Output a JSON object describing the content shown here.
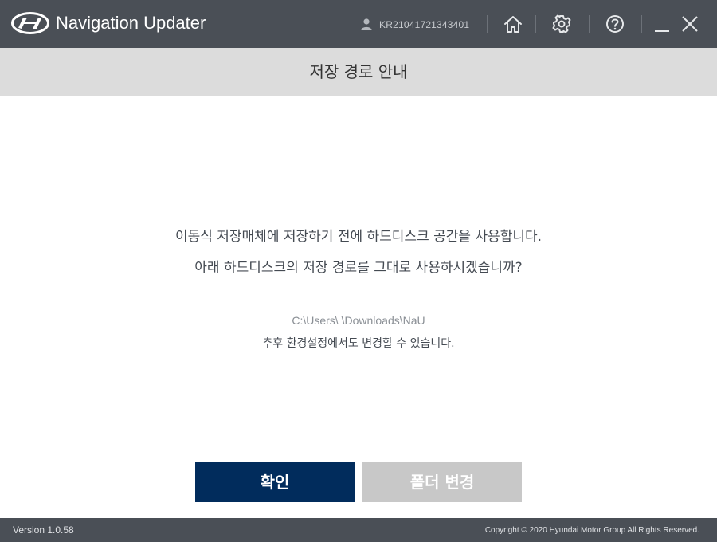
{
  "app": {
    "title": "Navigation Updater",
    "logo_icon": "hyundai-logo-icon",
    "user_id": "KR21041721343401"
  },
  "toolbar": {
    "icons": [
      "user-icon",
      "home-icon",
      "gear-icon",
      "help-icon",
      "minimize-icon",
      "close-icon"
    ]
  },
  "dialog": {
    "title": "저장 경로 안내",
    "message_line1": "이동식 저장매체에 저장하기 전에 하드디스크 공간을 사용합니다.",
    "message_line2": "아래 하드디스크의 저장 경로를 그대로 사용하시겠습니까?",
    "path": "C:\\Users\\     \\Downloads\\NaU",
    "note": "추후 환경설정에서도 변경할 수 있습니다.",
    "confirm_label": "확인",
    "change_folder_label": "폴더 변경"
  },
  "footer": {
    "version": "Version 1.0.58",
    "copyright": "Copyright © 2020 Hyundai Motor Group All Rights Reserved."
  },
  "colors": {
    "titlebar_bg": "#4a4f56",
    "subheader_bg": "#dcdcdc",
    "primary_button": "#012c5c",
    "secondary_button": "#c8c8c8"
  }
}
